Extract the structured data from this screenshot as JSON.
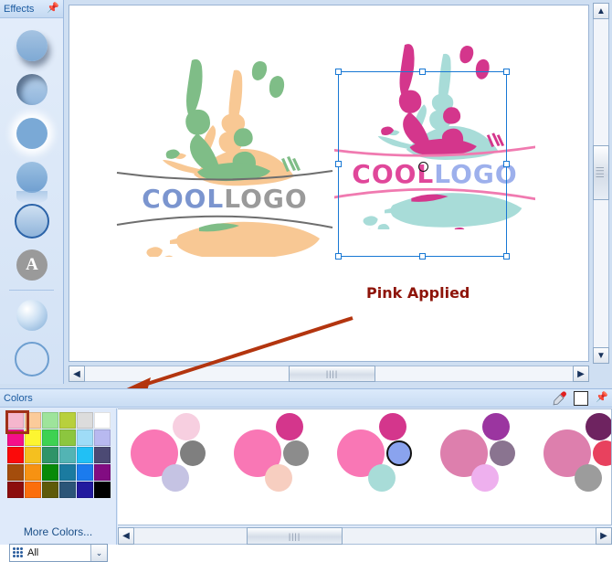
{
  "effects_panel": {
    "title": "Effects",
    "pin_icon": "pin-icon",
    "items": [
      {
        "name": "drop-shadow",
        "label": "Drop Shadow"
      },
      {
        "name": "inner-shadow",
        "label": "Inner Shadow"
      },
      {
        "name": "glow",
        "label": "Glow"
      },
      {
        "name": "reflection",
        "label": "Reflection"
      },
      {
        "name": "border",
        "label": "Border"
      },
      {
        "name": "text-effect",
        "label": "A"
      },
      {
        "name": "bevel",
        "label": "Bevel"
      },
      {
        "name": "outline",
        "label": "Outline"
      }
    ]
  },
  "canvas": {
    "logo_left": {
      "text_part1": "COOL",
      "text_part2": "LOGO",
      "color_part1": "#7b95cf",
      "color_part2": "#9a9a9a",
      "splash_color_a": "#f8c894",
      "splash_color_b": "#7fbd87",
      "line_color": "#6e6e6e"
    },
    "logo_right": {
      "text_part1": "COOL",
      "text_part2": "LOGO",
      "color_part1": "#e0479a",
      "color_part2": "#9db0ec",
      "splash_color_a": "#a8dcd8",
      "splash_color_b": "#d4368c",
      "line_color": "#f07ab0",
      "selected": true
    },
    "annotation_label": "Pink Applied",
    "annotation_label_color": "#8e1409",
    "arrow_color": "#b3350f",
    "cursor_icon": "pointer-with-marquee-cursor",
    "selection_handles": 8
  },
  "canvas_scrollbars": {
    "v_up": "▲",
    "v_down": "▼",
    "h_left": "◀",
    "h_right": "▶",
    "thumb_grip": "||||"
  },
  "colors_panel": {
    "title": "Colors",
    "eyedropper_icon": "eyedropper-icon",
    "current_color": "#ffffff",
    "pin_icon": "pin-icon",
    "more_colors_label": "More Colors...",
    "filter": {
      "icon": "grid-icon",
      "value": "All",
      "arrow": "⌄"
    },
    "selected_swatch_index": 0,
    "swatches": [
      "#f5b6cd",
      "#fbcb9a",
      "#9ee49b",
      "#b8d03c",
      "#dcdcdc",
      "#ffffff",
      "#f50f8a",
      "#fdf531",
      "#3ed252",
      "#8cc63f",
      "#9fdcf7",
      "#b8b9f0",
      "#fb0a0a",
      "#f5c01f",
      "#2f9468",
      "#53b4b4",
      "#21c0f5",
      "#4c4a74",
      "#a44d0c",
      "#f79212",
      "#088a08",
      "#1b7ba0",
      "#1b7bee",
      "#820c82",
      "#8c0d0d",
      "#fb6e0c",
      "#5e5a09",
      "#2b5578",
      "#221a9e",
      "#000000"
    ],
    "schemes": [
      {
        "big": "#f977b5",
        "s1": "#f7cfe0",
        "s2": "#7f7f7f",
        "s3": "#c5c3e3",
        "selected_dot": -1
      },
      {
        "big": "#f977b5",
        "s1": "#d4368c",
        "s2": "#8c8c8c",
        "s3": "#f7cec0",
        "selected_dot": -1
      },
      {
        "big": "#f977b5",
        "s1": "#d4368c",
        "s2": "#8aa3ee",
        "s3": "#a8dcd8",
        "selected_dot": 2
      },
      {
        "big": "#dd7fad",
        "s1": "#9b35a0",
        "s2": "#8a7490",
        "s3": "#eeb0ee",
        "selected_dot": -1
      },
      {
        "big": "#dd7fad",
        "s1": "#6e2360",
        "s2": "#e8415e",
        "s3": "#9c9c9c",
        "selected_dot": -1
      },
      {
        "big": "#f977b5",
        "s1": "#d4368c",
        "s2": "#8c8c8c",
        "s3": "#a8dcd8",
        "selected_dot": -1
      }
    ],
    "scroll": {
      "left": "◀",
      "right": "▶",
      "thumb_grip": "||||"
    }
  }
}
